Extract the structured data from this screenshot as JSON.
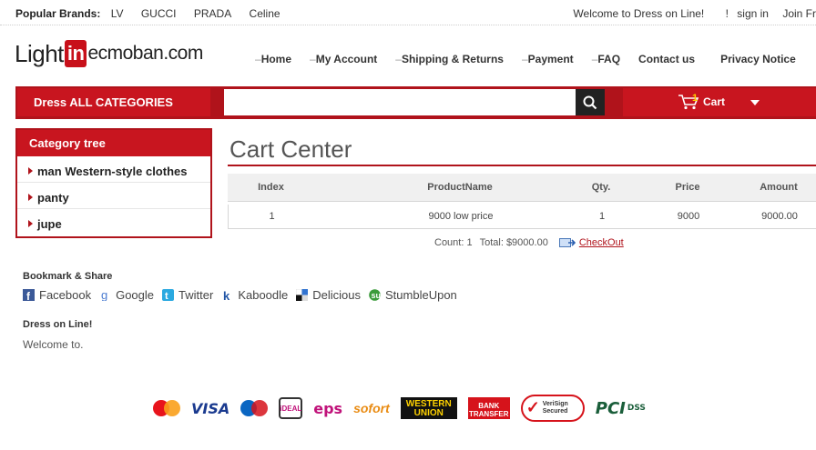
{
  "topbar": {
    "brands_label": "Popular Brands:",
    "brands": [
      "LV",
      "GUCCI",
      "PRADA",
      "Celine"
    ],
    "welcome": "Welcome to Dress on Line!",
    "signin": "sign in",
    "join": "Join Fr"
  },
  "logo": {
    "part1": "Light",
    "part2": "in",
    "part3": "ecmoban.com"
  },
  "nav": {
    "items": [
      "Home",
      "My Account",
      "Shipping & Returns",
      "Payment",
      "FAQ",
      "Contact us",
      "Privacy Notice"
    ]
  },
  "searchbar": {
    "categories_label": "Dress ALL CATEGORIES",
    "search_placeholder": "",
    "cart_count": "1",
    "cart_label": "Cart"
  },
  "category_tree": {
    "title": "Category tree",
    "items": [
      "man Western-style clothes",
      "panty",
      "jupe"
    ]
  },
  "bookmark": {
    "title": "Bookmark & Share",
    "items": [
      {
        "label": "Facebook",
        "icon": "facebook-icon",
        "color": "#3b5998"
      },
      {
        "label": "Google",
        "icon": "google-icon",
        "color": "#4a7bd0"
      },
      {
        "label": "Twitter",
        "icon": "twitter-icon",
        "color": "#2aa9e0"
      },
      {
        "label": "Kaboodle",
        "icon": "kaboodle-icon",
        "color": "#2256a6"
      },
      {
        "label": "Delicious",
        "icon": "delicious-icon",
        "color": "#3274d1"
      },
      {
        "label": "StumbleUpon",
        "icon": "stumbleupon-icon",
        "color": "#3b9b3b"
      }
    ]
  },
  "dress_online": {
    "title": "Dress on Line!",
    "text": "Welcome to."
  },
  "cart_center": {
    "title": "Cart Center",
    "columns": [
      "Index",
      "ProductName",
      "Qty.",
      "Price",
      "Amount"
    ],
    "rows": [
      [
        "1",
        "9000 low price",
        "1",
        "9000",
        "9000.00"
      ]
    ],
    "count_text": "Count: 1",
    "total_text": "Total: $9000.00",
    "checkout_label": "CheckOut"
  },
  "payments": {
    "visa": "VISA",
    "ideal": "iDEAL",
    "eps": "eps",
    "sofort": "sofort",
    "western_union": "WESTERN UNION",
    "bank_transfer": "BANK TRANSFER",
    "verisign": "VeriSign Secured",
    "pci": "PCI",
    "dss": "DSS"
  },
  "colors": {
    "brand_red": "#b0131b",
    "brand_red_light": "#c8151f"
  }
}
